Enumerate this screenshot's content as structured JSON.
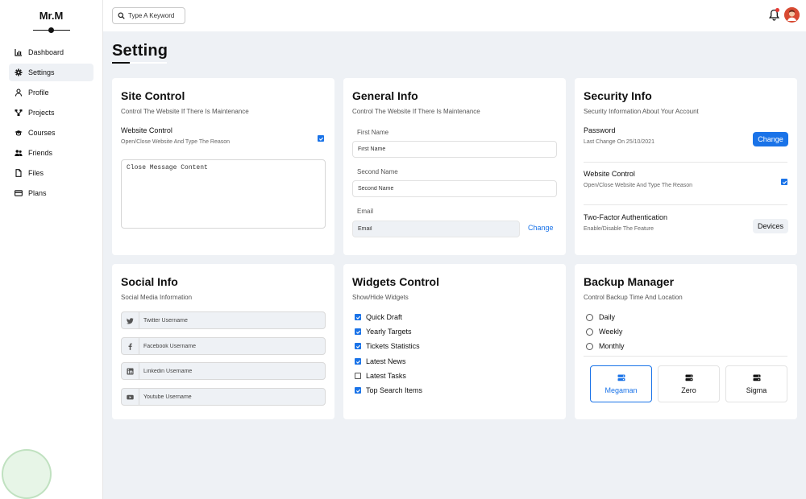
{
  "brand": "Mr.M",
  "sidebar": {
    "items": [
      {
        "label": "Dashboard",
        "icon": "chart-icon"
      },
      {
        "label": "Settings",
        "icon": "gear-icon"
      },
      {
        "label": "Profile",
        "icon": "user-icon"
      },
      {
        "label": "Projects",
        "icon": "diagram-icon"
      },
      {
        "label": "Courses",
        "icon": "graduation-cap-icon"
      },
      {
        "label": "Friends",
        "icon": "users-icon"
      },
      {
        "label": "Files",
        "icon": "file-icon"
      },
      {
        "label": "Plans",
        "icon": "credit-card-icon"
      }
    ],
    "active_index": 1
  },
  "header": {
    "search_placeholder": "Type A Keyword",
    "notification_dot_color": "#e53935"
  },
  "page": {
    "title": "Setting"
  },
  "site_control": {
    "title": "Site Control",
    "subtitle": "Control The Website If There Is Maintenance",
    "website_control_label": "Website Control",
    "website_control_hint": "Open/Close Website And Type The Reason",
    "website_control_checked": true,
    "message_placeholder": "Close Message Content"
  },
  "general_info": {
    "title": "General Info",
    "subtitle": "Control The Website If There Is Maintenance",
    "first_name_label": "First Name",
    "first_name_placeholder": "First Name",
    "second_name_label": "Second Name",
    "second_name_placeholder": "Second Name",
    "email_label": "Email",
    "email_placeholder": "Email",
    "change_link": "Change"
  },
  "security_info": {
    "title": "Security Info",
    "subtitle": "Security Information About Your Account",
    "password_label": "Password",
    "password_hint": "Last Change On 25/10/2021",
    "change_button": "Change",
    "website_control_label": "Website Control",
    "website_control_hint": "Open/Close Website And Type The Reason",
    "website_control_checked": true,
    "two_factor_label": "Two-Factor Authentication",
    "two_factor_hint": "Enable/Disable The Feature",
    "devices_button": "Devices"
  },
  "social_info": {
    "title": "Social Info",
    "subtitle": "Social Media Information",
    "fields": [
      {
        "icon": "twitter-icon",
        "placeholder": "Twitter Username"
      },
      {
        "icon": "facebook-icon",
        "placeholder": "Facebook Username"
      },
      {
        "icon": "linkedin-icon",
        "placeholder": "Linkedin Username"
      },
      {
        "icon": "youtube-icon",
        "placeholder": "Youtube Username"
      }
    ]
  },
  "widgets_control": {
    "title": "Widgets Control",
    "subtitle": "Show/Hide Widgets",
    "items": [
      {
        "label": "Quick Draft",
        "checked": true
      },
      {
        "label": "Yearly Targets",
        "checked": true
      },
      {
        "label": "Tickets Statistics",
        "checked": true
      },
      {
        "label": "Latest News",
        "checked": true
      },
      {
        "label": "Latest Tasks",
        "checked": false
      },
      {
        "label": "Top Search Items",
        "checked": true
      }
    ]
  },
  "backup_manager": {
    "title": "Backup Manager",
    "subtitle": "Control Backup Time And Location",
    "options": [
      "Daily",
      "Weekly",
      "Monthly"
    ],
    "servers": [
      {
        "label": "Megaman",
        "selected": true
      },
      {
        "label": "Zero",
        "selected": false
      },
      {
        "label": "Sigma",
        "selected": false
      }
    ]
  },
  "colors": {
    "accent": "#1a73e8",
    "background": "#eef1f5",
    "avatar": "#d84a32"
  }
}
